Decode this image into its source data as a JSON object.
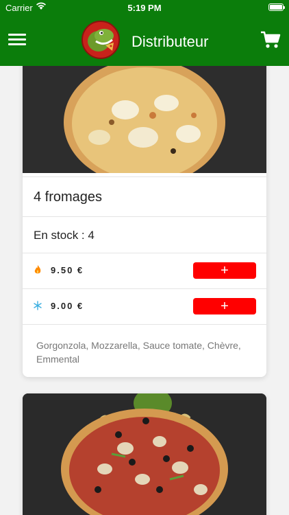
{
  "status": {
    "carrier": "Carrier",
    "time": "5:19 PM"
  },
  "header": {
    "title": "Distributeur",
    "menu_icon": "hamburger-menu-icon",
    "cart_icon": "cart-icon"
  },
  "colors": {
    "nav_bg": "#0b7d0b",
    "add_button": "#ff0000",
    "hot_icon": "#ff8a00",
    "cold_icon": "#3aaee0"
  },
  "products": [
    {
      "name": "4 fromages",
      "stock_text": "En stock : 4",
      "prices": [
        {
          "icon": "flame-icon",
          "value": "9.50 €",
          "button": "+"
        },
        {
          "icon": "snowflake-icon",
          "value": "9.00 €",
          "button": "+"
        }
      ],
      "description": "Gorgonzola, Mozzarella, Sauce tomate, Chèvre, Emmental"
    }
  ]
}
